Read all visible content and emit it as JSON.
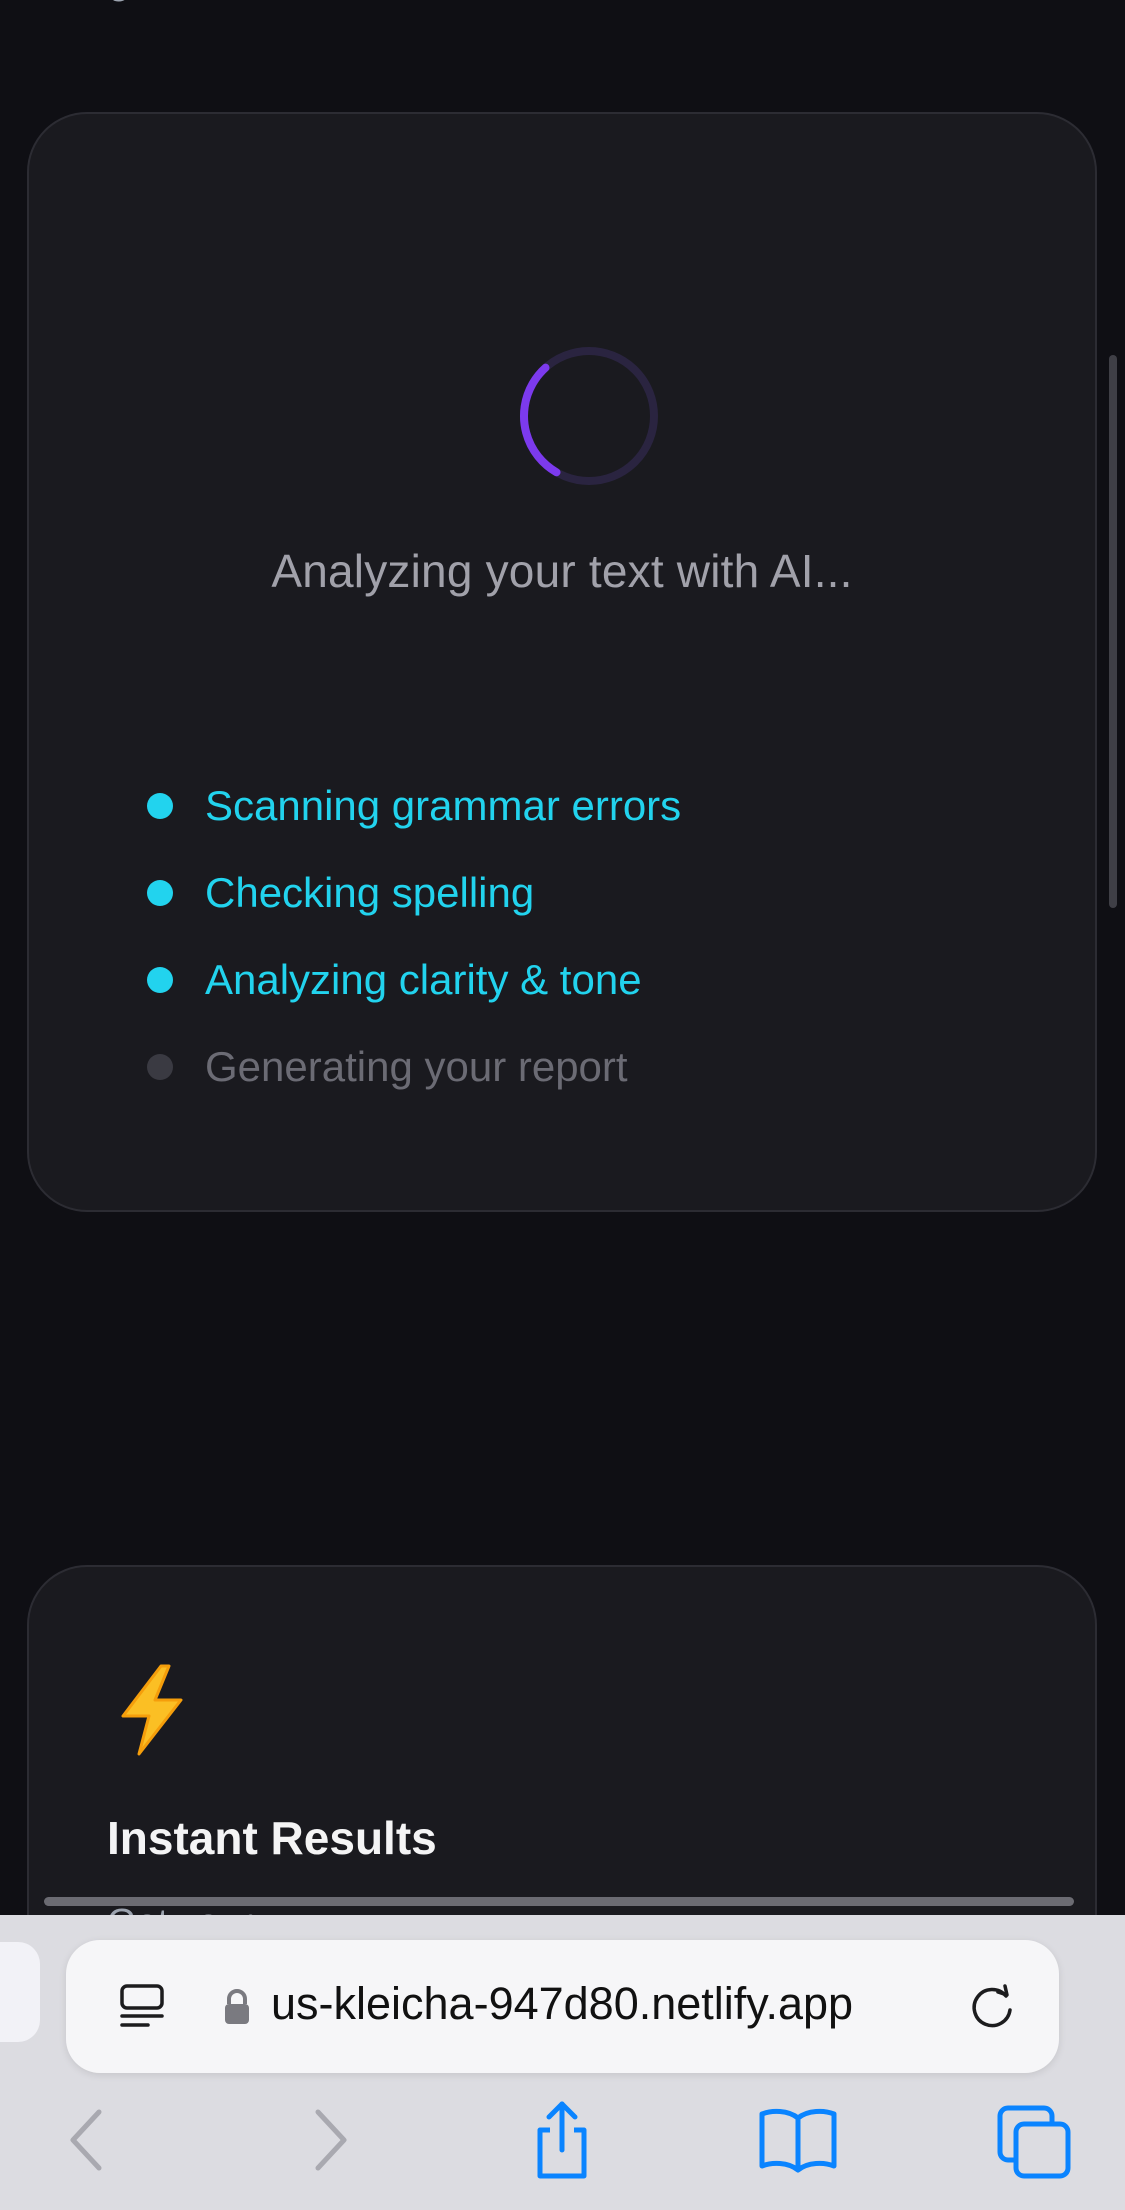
{
  "loading": {
    "status_text": "Analyzing your text with AI...",
    "progress_fraction": 0.3,
    "steps": [
      {
        "label": "Scanning grammar errors",
        "state": "done"
      },
      {
        "label": "Checking spelling",
        "state": "done"
      },
      {
        "label": "Analyzing clarity & tone",
        "state": "done"
      },
      {
        "label": "Generating your report",
        "state": "pending"
      }
    ]
  },
  "feature": {
    "icon": "lightning-icon",
    "title": "Instant Results",
    "description_partial": "Get your ..."
  },
  "browser": {
    "url": "us-kleicha-947d80.netlify.app",
    "icons": [
      "reader-mode-icon",
      "lock-icon",
      "reload-icon",
      "back-icon",
      "forward-icon",
      "share-icon",
      "bookmarks-icon",
      "tabs-icon"
    ]
  },
  "colors": {
    "accent_cyan": "#22d3ee",
    "spinner_purple": "#7c3aed",
    "background": "#0f0f14",
    "card": "#1a1a1f"
  }
}
